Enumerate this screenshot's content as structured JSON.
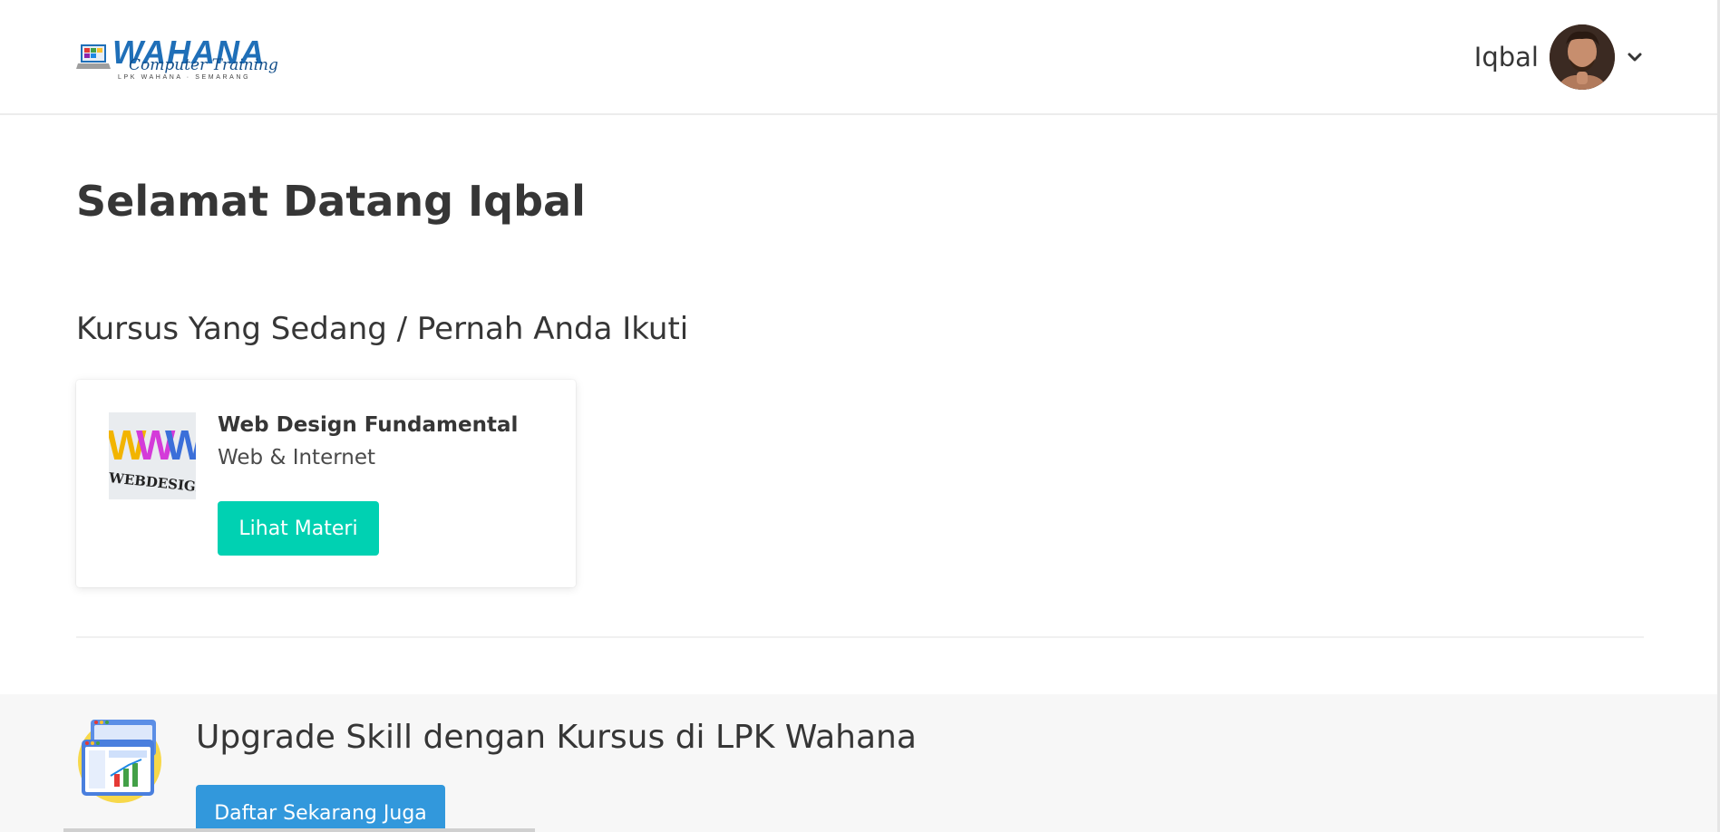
{
  "header": {
    "logo": {
      "wordmark": "WAHANA",
      "script": "Computer Training",
      "subtitle": "LPK WAHANA · SEMARANG"
    },
    "user_name": "Iqbal",
    "avatar_icon": "user-avatar",
    "dropdown_icon": "chevron-down-icon"
  },
  "main": {
    "welcome": "Selamat Datang Iqbal",
    "courses_heading": "Kursus Yang Sedang / Pernah Anda Ikuti",
    "courses": [
      {
        "title": "Web Design Fundamental",
        "category": "Web & Internet",
        "thumbnail_text": "WEBDESIGN",
        "button_label": "Lihat Materi"
      }
    ]
  },
  "promo": {
    "title": "Upgrade Skill dengan Kursus di LPK Wahana",
    "button_label": "Daftar Sekarang Juga",
    "icon": "dashboard-illustration-icon"
  },
  "colors": {
    "primary": "#00d1b2",
    "info": "#3298dc",
    "text": "#363636",
    "promo_bg": "#f7f7f7"
  }
}
